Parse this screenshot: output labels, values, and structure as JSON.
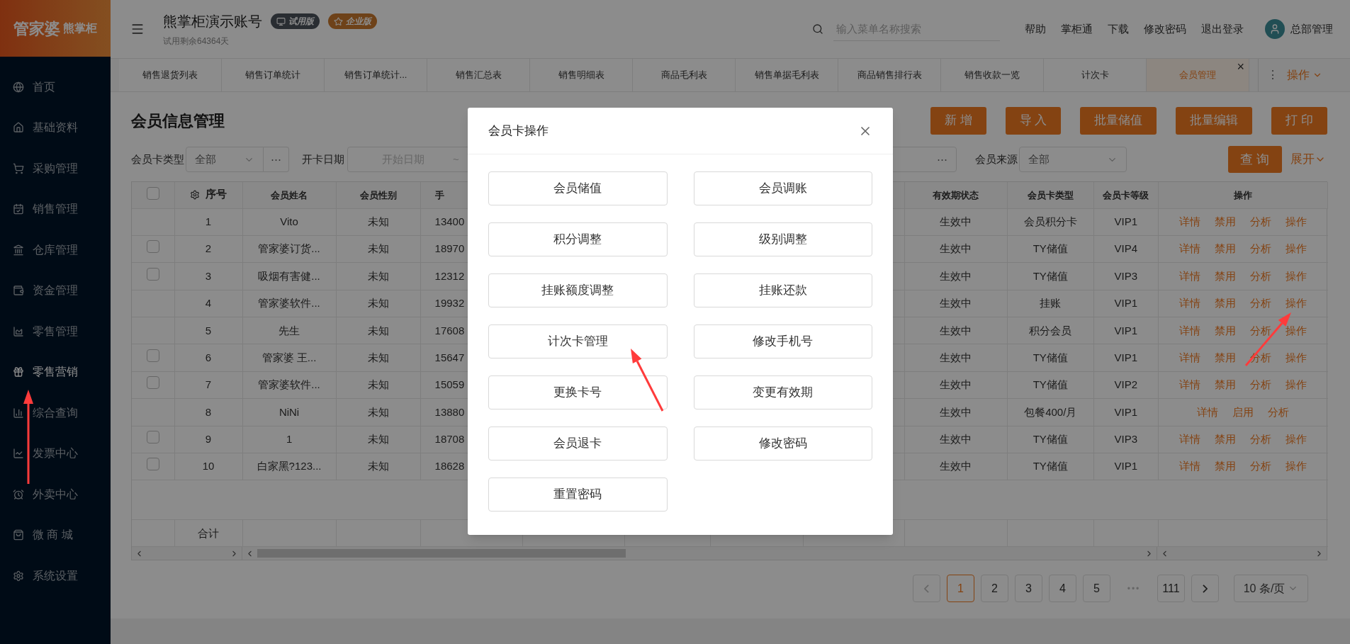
{
  "logo": {
    "brand": "管家婆",
    "product": "熊掌柜"
  },
  "header": {
    "account": "熊掌柜演示账号",
    "badges": [
      "试用版",
      "企业版"
    ],
    "trial_note": "试用剩余64364天",
    "search": {
      "placeholder": "输入菜单名称搜索"
    },
    "links": [
      "帮助",
      "掌柜通",
      "下载",
      "修改密码",
      "退出登录"
    ],
    "user": "总部管理"
  },
  "sidebar": {
    "items": [
      {
        "label": "首页",
        "selected": false
      },
      {
        "label": "基础资料",
        "selected": false
      },
      {
        "label": "采购管理",
        "selected": false
      },
      {
        "label": "销售管理",
        "selected": false
      },
      {
        "label": "仓库管理",
        "selected": false
      },
      {
        "label": "资金管理",
        "selected": false
      },
      {
        "label": "零售管理",
        "selected": false
      },
      {
        "label": "零售营销",
        "selected": true
      },
      {
        "label": "综合查询",
        "selected": false
      },
      {
        "label": "发票中心",
        "selected": false
      },
      {
        "label": "外卖中心",
        "selected": false
      },
      {
        "label": "微 商 城",
        "selected": false
      },
      {
        "label": "系统设置",
        "selected": false
      }
    ]
  },
  "tabs": [
    {
      "label": "销售退货列表",
      "selected": false
    },
    {
      "label": "销售订单统计",
      "selected": false
    },
    {
      "label": "销售订单统计...",
      "selected": false
    },
    {
      "label": "销售汇总表",
      "selected": false
    },
    {
      "label": "销售明细表",
      "selected": false
    },
    {
      "label": "商品毛利表",
      "selected": false
    },
    {
      "label": "销售单据毛利表",
      "selected": false
    },
    {
      "label": "商品销售排行表",
      "selected": false
    },
    {
      "label": "销售收款一览",
      "selected": false
    },
    {
      "label": "计次卡",
      "selected": false
    },
    {
      "label": "会员管理",
      "selected": true
    }
  ],
  "tab_tools": {
    "close": "×",
    "more": "⋮",
    "menu": "操作"
  },
  "page": {
    "title": "会员信息管理",
    "actions": [
      "新 增",
      "导 入",
      "批量储值",
      "批量编辑",
      "打 印"
    ]
  },
  "filters": {
    "card_type_label": "会员卡类型",
    "card_type_value": "全部",
    "more": "⋯",
    "open_date_label": "开卡日期",
    "open_date_placeholder": "开始日期",
    "range_sep": "~",
    "field_more": "⋯",
    "source_label": "会员来源",
    "source_value": "全部",
    "query": "查 询",
    "expand": "展开"
  },
  "table": {
    "columns": [
      "序号",
      "会员姓名",
      "会员性别",
      "手",
      "",
      "",
      "",
      "",
      "有效期状态",
      "会员卡类型",
      "会员卡等级",
      "操作"
    ],
    "rows": [
      {
        "selectable": false,
        "seq": "1",
        "name": "Vito",
        "gender": "未知",
        "phone": "13400",
        "status": "生效中",
        "card_type": "会员积分卡",
        "level": "VIP1",
        "ops": [
          "详情",
          "禁用",
          "分析",
          "操作"
        ]
      },
      {
        "selectable": true,
        "checked": false,
        "seq": "2",
        "name": "管家婆订货...",
        "gender": "未知",
        "phone": "18970",
        "status": "生效中",
        "card_type": "TY储值",
        "level": "VIP4",
        "ops": [
          "详情",
          "禁用",
          "分析",
          "操作"
        ]
      },
      {
        "selectable": true,
        "checked": false,
        "seq": "3",
        "name": "吸烟有害健...",
        "gender": "未知",
        "phone": "12312",
        "status": "生效中",
        "card_type": "TY储值",
        "level": "VIP3",
        "ops": [
          "详情",
          "禁用",
          "分析",
          "操作"
        ]
      },
      {
        "selectable": false,
        "seq": "4",
        "name": "管家婆软件...",
        "gender": "未知",
        "phone": "19932",
        "status": "生效中",
        "card_type": "挂账",
        "level": "VIP1",
        "ops": [
          "详情",
          "禁用",
          "分析",
          "操作"
        ]
      },
      {
        "selectable": false,
        "seq": "5",
        "name": "先生",
        "gender": "未知",
        "phone": "17608",
        "status": "生效中",
        "card_type": "积分会员",
        "level": "VIP1",
        "ops": [
          "详情",
          "禁用",
          "分析",
          "操作"
        ]
      },
      {
        "selectable": true,
        "checked": false,
        "seq": "6",
        "name": "管家婆 王...",
        "gender": "未知",
        "phone": "15647",
        "status": "生效中",
        "card_type": "TY储值",
        "level": "VIP1",
        "ops": [
          "详情",
          "禁用",
          "分析",
          "操作"
        ]
      },
      {
        "selectable": true,
        "checked": false,
        "seq": "7",
        "name": "管家婆软件...",
        "gender": "未知",
        "phone": "15059",
        "status": "生效中",
        "card_type": "TY储值",
        "level": "VIP2",
        "ops": [
          "详情",
          "禁用",
          "分析",
          "操作"
        ]
      },
      {
        "selectable": false,
        "seq": "8",
        "name": "NiNi",
        "gender": "未知",
        "phone": "13880",
        "status": "生效中",
        "card_type": "包餐400/月",
        "level": "VIP1",
        "ops": [
          "详情",
          "启用",
          "分析"
        ]
      },
      {
        "selectable": true,
        "checked": false,
        "seq": "9",
        "name": "1",
        "gender": "未知",
        "phone": "18708",
        "status": "生效中",
        "card_type": "TY储值",
        "level": "VIP3",
        "ops": [
          "详情",
          "禁用",
          "分析",
          "操作"
        ]
      },
      {
        "selectable": true,
        "checked": false,
        "seq": "10",
        "name": "白家黑?123...",
        "gender": "未知",
        "phone": "18628",
        "status": "生效中",
        "card_type": "TY储值",
        "level": "VIP1",
        "ops": [
          "详情",
          "禁用",
          "分析",
          "操作"
        ]
      }
    ],
    "total_label": "合计",
    "select_all": {
      "checked": false
    }
  },
  "pagination": {
    "pages": [
      {
        "label": "1",
        "selected": true
      },
      {
        "label": "2",
        "selected": false
      },
      {
        "label": "3",
        "selected": false
      },
      {
        "label": "4",
        "selected": false
      },
      {
        "label": "5",
        "selected": false
      }
    ],
    "ellipsis": "•••",
    "last": "111",
    "page_size": "10 条/页"
  },
  "dialog": {
    "title": "会员卡操作",
    "buttons": [
      "会员储值",
      "会员调账",
      "积分调整",
      "级别调整",
      "挂账额度调整",
      "挂账还款",
      "计次卡管理",
      "修改手机号",
      "更换卡号",
      "变更有效期",
      "会员退卡",
      "修改密码",
      "重置密码"
    ]
  }
}
